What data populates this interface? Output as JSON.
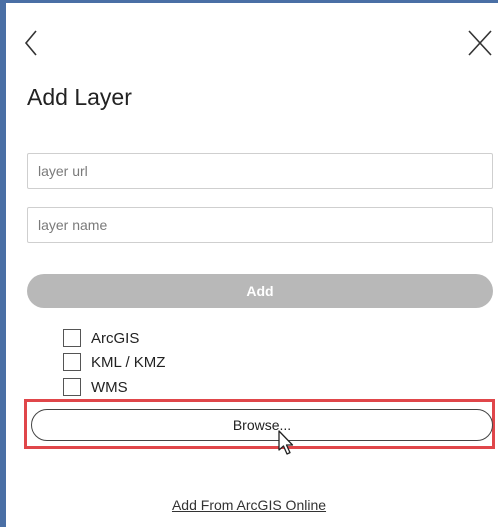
{
  "header": {
    "back_icon": "chevron-left-icon",
    "close_icon": "close-icon",
    "title": "Add Layer"
  },
  "form": {
    "url_placeholder": "layer url",
    "url_value": "",
    "name_placeholder": "layer name",
    "name_value": "",
    "add_label": "Add"
  },
  "layer_types": [
    {
      "label": "ArcGIS",
      "checked": false
    },
    {
      "label": "KML / KMZ",
      "checked": false
    },
    {
      "label": "WMS",
      "checked": false
    }
  ],
  "browse_label": "Browse...",
  "online_link": "Add From ArcGIS Online",
  "colors": {
    "accent_border": "#4a6fa5",
    "highlight": "#e0464a",
    "disabled_button": "#b8b8b8"
  }
}
